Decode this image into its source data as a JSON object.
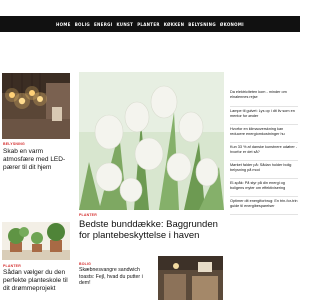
{
  "nav": {
    "items": [
      "HOME",
      "BOLIG",
      "ENERGI",
      "KUNST",
      "PLANTER",
      "KØKKEN",
      "BELYSNING",
      "ØKONOMI"
    ]
  },
  "articles": {
    "left_top": {
      "category": "BELYSNING",
      "title": "Skab en varm atmosfære med LED-pærer til dit hjem"
    },
    "feature": {
      "category": "PLANTER",
      "title": "Bedste bunddække: Baggrunden for plantebeskyttelse i haven"
    },
    "left_bottom": {
      "category": "PLANTER",
      "title": "Sådan vælger du den perfekte planteskole til dit drømmeprojekt"
    },
    "center_bottom": {
      "category": "BOLIG",
      "title": "Skæbnesvangre sandwich toasts: Fejl, hvad du putter i dem!"
    }
  },
  "sidebar": {
    "items": [
      "Da elektriciteten kom - minder om elnalennes rejse",
      "Lampe til gulvet: Lys op i dit liv som en mentor for ønder",
      "Hvorfor en klimaoverskning kan reducere energiomkostninger hu",
      "Kun 33 % af danske kunstnere udøber - hvorfor er det så?",
      "Mørket falder på: Sådan holder bolig belysning på mod",
      "El-spåk: På styr på din energi og boligens myter om effektivisering",
      "Optimer dit energiforbrug: En trin-for-trin guide til energibesparelser"
    ]
  },
  "colors": {
    "nav_bg": "#111111",
    "category": "#d42b2b"
  }
}
